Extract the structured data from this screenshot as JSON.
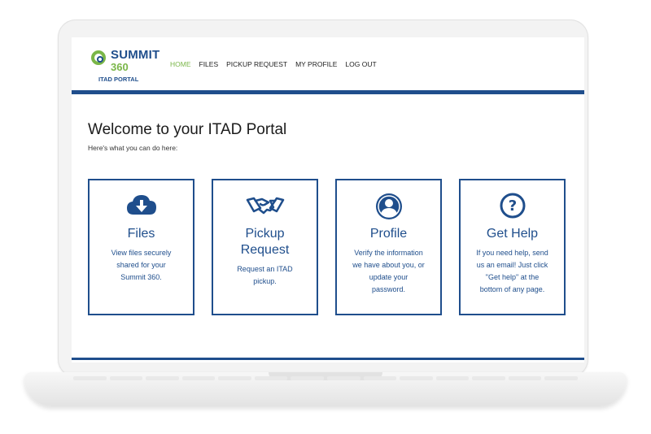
{
  "logo": {
    "name_line1": "SUMMIT",
    "name_line2": "360",
    "subtitle": "ITAD PORTAL",
    "colors": {
      "primary": "#1f4e8c",
      "accent": "#7ab648"
    }
  },
  "nav": {
    "items": [
      {
        "label": "HOME",
        "active": true
      },
      {
        "label": "FILES"
      },
      {
        "label": "PICKUP REQUEST"
      },
      {
        "label": "MY PROFILE"
      },
      {
        "label": "LOG OUT"
      }
    ]
  },
  "main": {
    "title": "Welcome to your ITAD Portal",
    "subtitle": "Here's what you can do here:"
  },
  "cards": [
    {
      "icon": "cloud-download-icon",
      "title_lines": [
        "Files"
      ],
      "desc_lines": [
        "View files securely",
        "shared for your",
        "Summit 360."
      ]
    },
    {
      "icon": "handshake-icon",
      "title_lines": [
        "Pickup",
        "Request"
      ],
      "desc_lines": [
        "Request an ITAD",
        "pickup."
      ]
    },
    {
      "icon": "user-profile-icon",
      "title_lines": [
        "Profile"
      ],
      "desc_lines": [
        "Verify the information",
        "we have about you, or",
        "update your",
        "password."
      ]
    },
    {
      "icon": "question-circle-icon",
      "title_lines": [
        "Get Help"
      ],
      "desc_lines": [
        "If you need help, send",
        "us an email! Just click",
        "\"Get help\" at the",
        "bottom of any page."
      ]
    }
  ]
}
